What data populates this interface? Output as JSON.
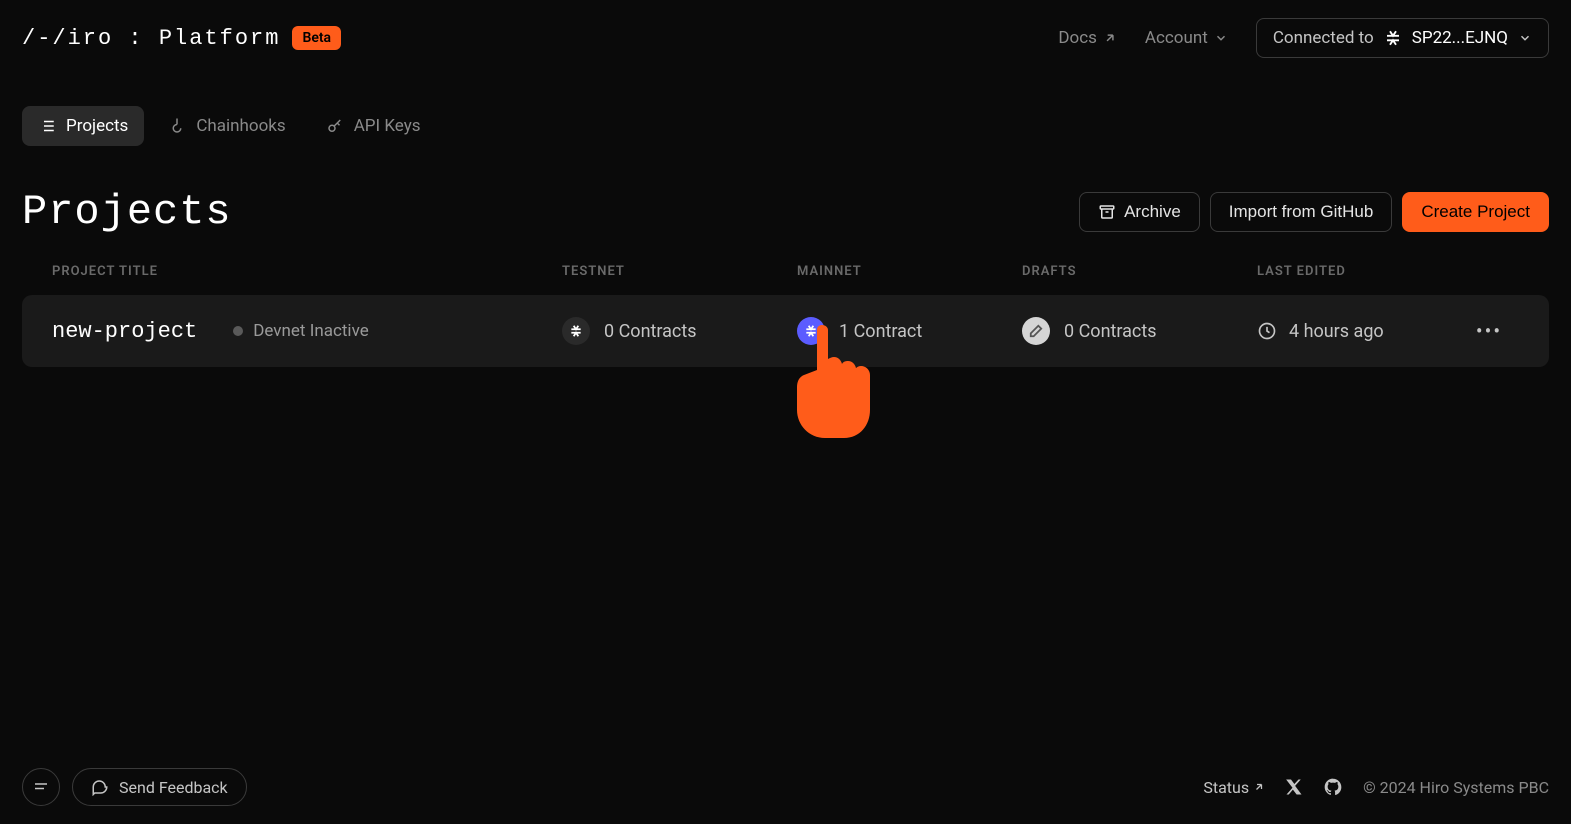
{
  "header": {
    "logo": "/-/iro : Platform",
    "beta_label": "Beta",
    "docs_label": "Docs",
    "account_label": "Account",
    "connected_prefix": "Connected to",
    "wallet_address": "SP22...EJNQ"
  },
  "nav": {
    "tabs": [
      {
        "label": "Projects",
        "active": true
      },
      {
        "label": "Chainhooks",
        "active": false
      },
      {
        "label": "API Keys",
        "active": false
      }
    ]
  },
  "page": {
    "title": "Projects",
    "archive_label": "Archive",
    "import_label": "Import from GitHub",
    "create_label": "Create Project"
  },
  "table": {
    "columns": {
      "title": "PROJECT TITLE",
      "testnet": "TESTNET",
      "mainnet": "MAINNET",
      "drafts": "DRAFTS",
      "last_edited": "LAST EDITED"
    },
    "rows": [
      {
        "name": "new-project",
        "devnet_status": "Devnet Inactive",
        "testnet_count": "0 Contracts",
        "mainnet_count": "1 Contract",
        "drafts_count": "0 Contracts",
        "last_edited": "4 hours ago"
      }
    ]
  },
  "footer": {
    "feedback_label": "Send Feedback",
    "status_label": "Status",
    "copyright": "© 2024 Hiro Systems PBC"
  }
}
